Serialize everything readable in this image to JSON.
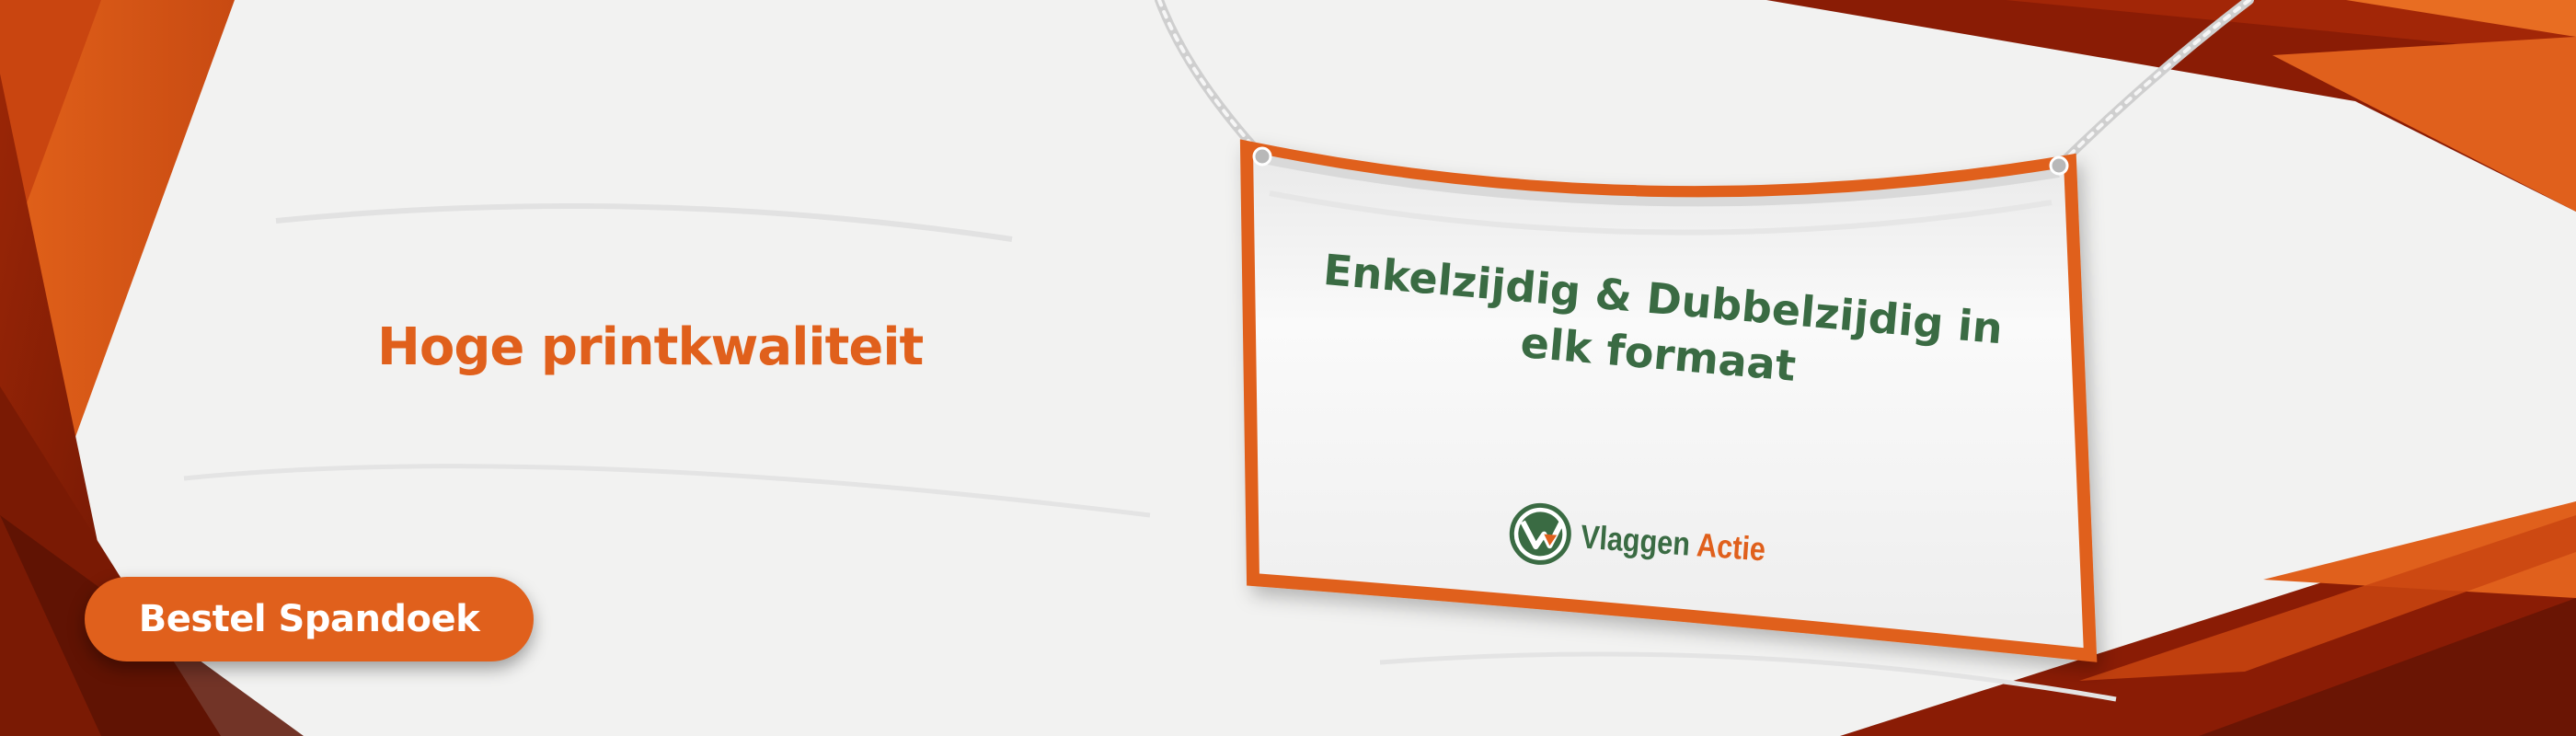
{
  "headline": "Hoge printkwaliteit",
  "cta_label": "Bestel Spandoek",
  "banner": {
    "line1": "Enkelzijdig & Dubbelzijdig in",
    "line2": "elk formaat"
  },
  "logo": {
    "icon": "vlaggen-actie-logo-mark",
    "word1": "Vlaggen",
    "word2": "Actie"
  },
  "colors": {
    "brand_orange": "#e0601c",
    "brand_green": "#3a6b43",
    "dark_red": "#8a1c05",
    "paper_white": "#f2f2f1"
  }
}
